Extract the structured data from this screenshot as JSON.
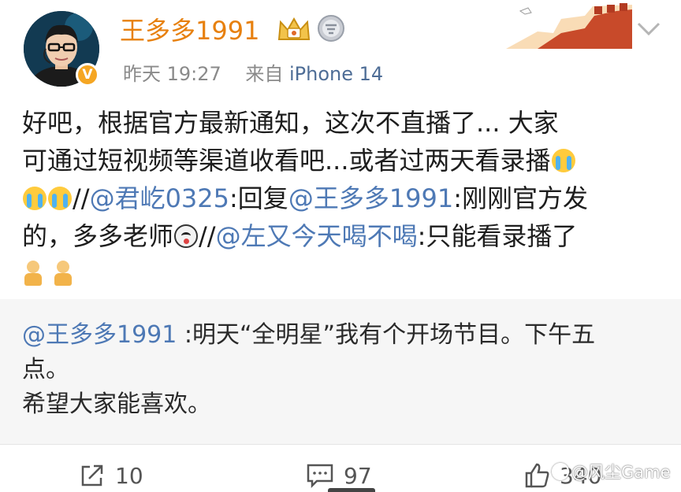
{
  "author": {
    "name": "王多多1991",
    "verified_badge": "V",
    "timestamp": "昨天 19:27",
    "source_prefix": "来自",
    "device": "iPhone 14"
  },
  "post": {
    "line1": "好吧，根据官方最新通知，这次不直播了... 大家",
    "line2": "可通过短视频等渠道收看吧...或者过两天看录播",
    "slash1": "//",
    "mention1": "@君屹0325",
    "reply_text": ":回复",
    "mention2": "@王多多1991",
    "quote1_start": ":刚刚官方发",
    "quote1_end": "的，多多老师",
    "slash2": "//",
    "mention3": "@左又今天喝不喝",
    "quote2": ":只能看录播了"
  },
  "repost": {
    "mention": "@王多多1991",
    "line1": " :明天“全明星”我有个开场节目。下午五",
    "line2": "点。",
    "line3": "希望大家能喜欢。"
  },
  "actions": {
    "share_count": "10",
    "comment_count": "97",
    "like_count": "340"
  },
  "watermark": "@风尘Game",
  "icons": {
    "share": "share-icon",
    "comment": "comment-icon",
    "like": "thumbs-up-icon",
    "more": "chevron-down-icon"
  },
  "colors": {
    "username": "#e7800e",
    "mention": "#4e79b5",
    "device": "#4e6d96",
    "repost_bg": "#f6f6f6"
  }
}
